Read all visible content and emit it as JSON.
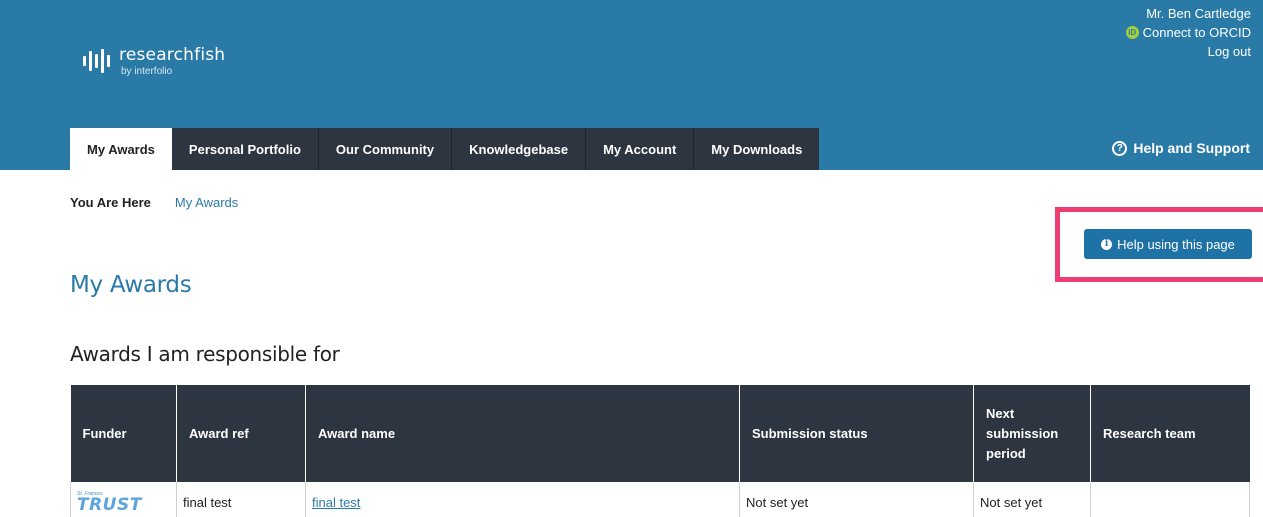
{
  "brand": {
    "name": "researchfish",
    "sub": "by interfolio"
  },
  "user": {
    "name": "Mr. Ben Cartledge",
    "orcid_label": "Connect to ORCID",
    "orcid_icon": "iD",
    "logout_label": "Log out"
  },
  "nav": {
    "tabs": [
      {
        "label": "My Awards",
        "active": true
      },
      {
        "label": "Personal Portfolio"
      },
      {
        "label": "Our Community"
      },
      {
        "label": "Knowledgebase"
      },
      {
        "label": "My Account"
      },
      {
        "label": "My Downloads"
      }
    ],
    "help_support": "Help and Support"
  },
  "breadcrumb": {
    "label": "You Are Here",
    "current": "My Awards"
  },
  "help_page_button": "Help using this page",
  "page_title": "My Awards",
  "section_title": "Awards I am responsible for",
  "table": {
    "headers": {
      "funder": "Funder",
      "award_ref": "Award ref",
      "award_name": "Award name",
      "submission_status": "Submission status",
      "next_period": "Next submission period",
      "research_team": "Research team"
    },
    "rows": [
      {
        "funder_logo_small": "St. Frances",
        "funder_logo_big": "TRUST",
        "award_ref": "final test",
        "award_name": "final test",
        "submission_status": "Not set yet",
        "next_period": "Not set yet",
        "research_team": ""
      }
    ]
  },
  "colors": {
    "header_bg": "#2a7aa8",
    "nav_bg": "#2d3540",
    "highlight": "#ee3d73",
    "button_bg": "#1f72a6"
  }
}
